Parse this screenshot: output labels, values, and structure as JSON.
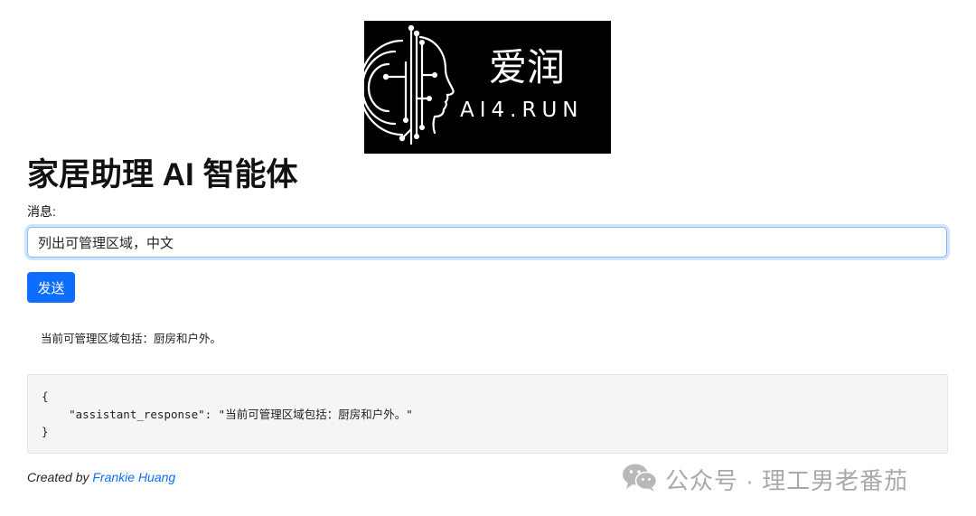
{
  "logo": {
    "cn_text": "爱润",
    "en_text": "AI4.RUN"
  },
  "page": {
    "title": "家居助理 AI 智能体"
  },
  "form": {
    "label": "消息:",
    "input_value": "列出可管理区域，中文",
    "send_label": "发送"
  },
  "response": {
    "text": "当前可管理区域包括：厨房和户外。",
    "json_open": "{",
    "json_line": "    \"assistant_response\": \"当前可管理区域包括：厨房和户外。\"",
    "json_close": "}"
  },
  "footer": {
    "created_by": "Created by",
    "author": "Frankie Huang"
  },
  "watermark": {
    "text": "公众号 · 理工男老番茄",
    "icon": "wechat-icon"
  },
  "colors": {
    "primary": "#0d6efd",
    "code_bg": "#f4f5f7",
    "logo_bg": "#000000"
  }
}
